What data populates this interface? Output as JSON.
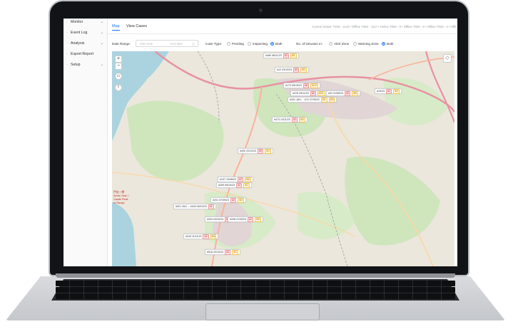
{
  "sidebar": {
    "items": [
      {
        "label": "Monitor",
        "icon": "monitor-icon",
        "has_children": true
      },
      {
        "label": "Event Log",
        "icon": "event-log-icon",
        "has_children": true
      },
      {
        "label": "Analysis",
        "icon": "analysis-icon",
        "has_children": true
      },
      {
        "label": "Export Report",
        "icon": "export-icon",
        "has_children": false
      },
      {
        "label": "Setup",
        "icon": "setup-icon",
        "has_children": true
      }
    ]
  },
  "tabs": [
    {
      "label": "Map",
      "active": true
    },
    {
      "label": "View Cases",
      "active": false
    }
  ],
  "status_bar": "Current Status: TIMS - 1143 • Offline  TIMS - 1127 • Online  TIMS - 5 • Offline  TIMS - 8 • Offline  TIMS - 3 • Offli",
  "filters": {
    "date_range_label": "Date Range:",
    "start_placeholder": "Start date",
    "arrow": "→",
    "end_placeholder": "End date",
    "case_type_label": "Case Type:",
    "case_type_options": [
      {
        "label": "Pending",
        "selected": false
      },
      {
        "label": "Inspecting",
        "selected": false
      },
      {
        "label": "Both",
        "selected": true
      }
    ],
    "intrusion_label": "No. of intrusion in:",
    "intrusion_options": [
      {
        "label": "Alert Zone",
        "selected": false
      },
      {
        "label": "Warning Zone",
        "selected": false
      },
      {
        "label": "Both",
        "selected": true
      }
    ]
  },
  "map": {
    "zoom_in": "+",
    "zoom_out": "−",
    "home": "⌂",
    "info": "!",
    "layers": "◇",
    "place_text": [
      "門屯一帶",
      "Ambo Tuen /",
      "Castle Peak",
      "rh Range"
    ],
    "markers": [
      {
        "text": "#480 08/11/23",
        "tags": [
          "A2",
          "W1"
        ]
      },
      {
        "text": "#12 03/10/23",
        "tags": [
          "A2",
          "W1"
        ]
      },
      {
        "text": "#173 06/10/23",
        "tags": [
          "A8",
          "W13"
        ]
      },
      {
        "text": "#478 29/11/23",
        "tags": [
          "A6",
          "W21"
        ]
      },
      {
        "text": "#22 31/05/23",
        "tags": [
          "A2",
          "W5"
        ]
      },
      {
        "text": "#431 18/1… #74 27/05/23",
        "tags": [
          "W1",
          "W9"
        ]
      },
      {
        "text": "#10/23",
        "tags": [
          "A1",
          "W2"
        ]
      },
      {
        "text": "#473 14/11/23",
        "tags": [
          "A2",
          "W4"
        ]
      },
      {
        "text": "#490 20/12/23",
        "tags": [
          "A5",
          "W1"
        ]
      },
      {
        "text": "#137 10/08/23",
        "tags": [
          "A2",
          "W6"
        ]
      },
      {
        "text": "#250 09/10/23",
        "tags": [
          "A3",
          "W1"
        ]
      },
      {
        "text": "#201 07/09/23",
        "tags": [
          "A2",
          "W3"
        ]
      },
      {
        "text": "#521 26/1… #163 06/10/23",
        "tags": [
          "A1"
        ]
      },
      {
        "text": "#204 04/10/23",
        "tags": [
          "A2"
        ]
      },
      {
        "text": "#208 21/09/23",
        "tags": [
          "A1",
          "W9"
        ]
      },
      {
        "text": "#243 11/11/23",
        "tags": [
          "A2",
          "W6"
        ]
      },
      {
        "text": "#516 20/10/23",
        "tags": [
          "A2",
          "W1"
        ]
      }
    ]
  }
}
